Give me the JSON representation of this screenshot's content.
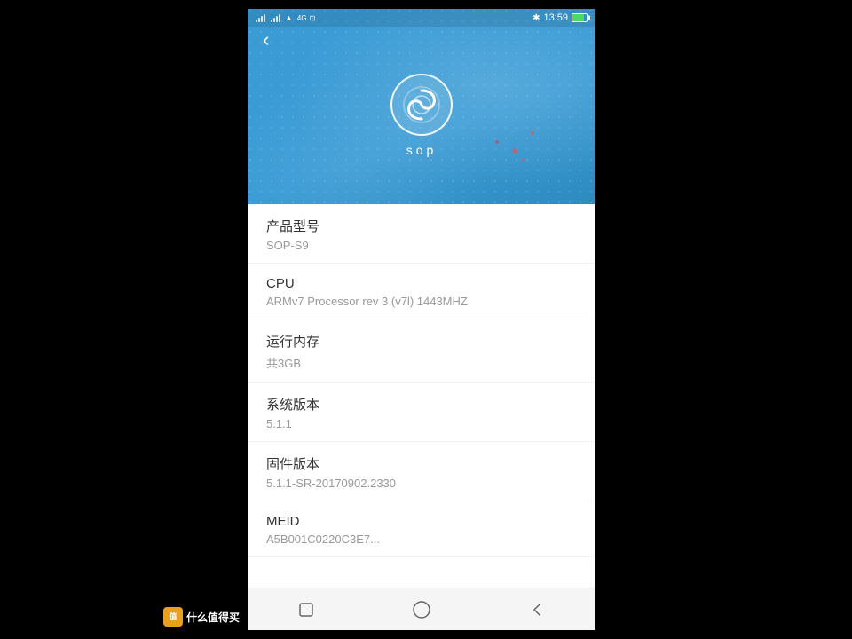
{
  "statusBar": {
    "time": "13:59",
    "bluetooth": "✱",
    "icons": [
      "signal",
      "wifi",
      "data"
    ]
  },
  "hero": {
    "logoAlt": "SOP Logo",
    "brandName": "sop"
  },
  "backButton": "‹",
  "infoItems": [
    {
      "label": "产品型号",
      "value": "SOP-S9"
    },
    {
      "label": "CPU",
      "value": "ARMv7 Processor rev 3 (v7l) 1443MHZ"
    },
    {
      "label": "运行内存",
      "value": "共3GB"
    },
    {
      "label": "系统版本",
      "value": "5.1.1"
    },
    {
      "label": "固件版本",
      "value": "5.1.1-SR-20170902.2330"
    },
    {
      "label": "MEID",
      "value": "A5B001C0220C3E7..."
    }
  ],
  "bottomNav": {
    "square": "☐",
    "circle": "○",
    "back": "‹"
  },
  "watermark": {
    "icon": "值",
    "text": "什么值得买"
  }
}
